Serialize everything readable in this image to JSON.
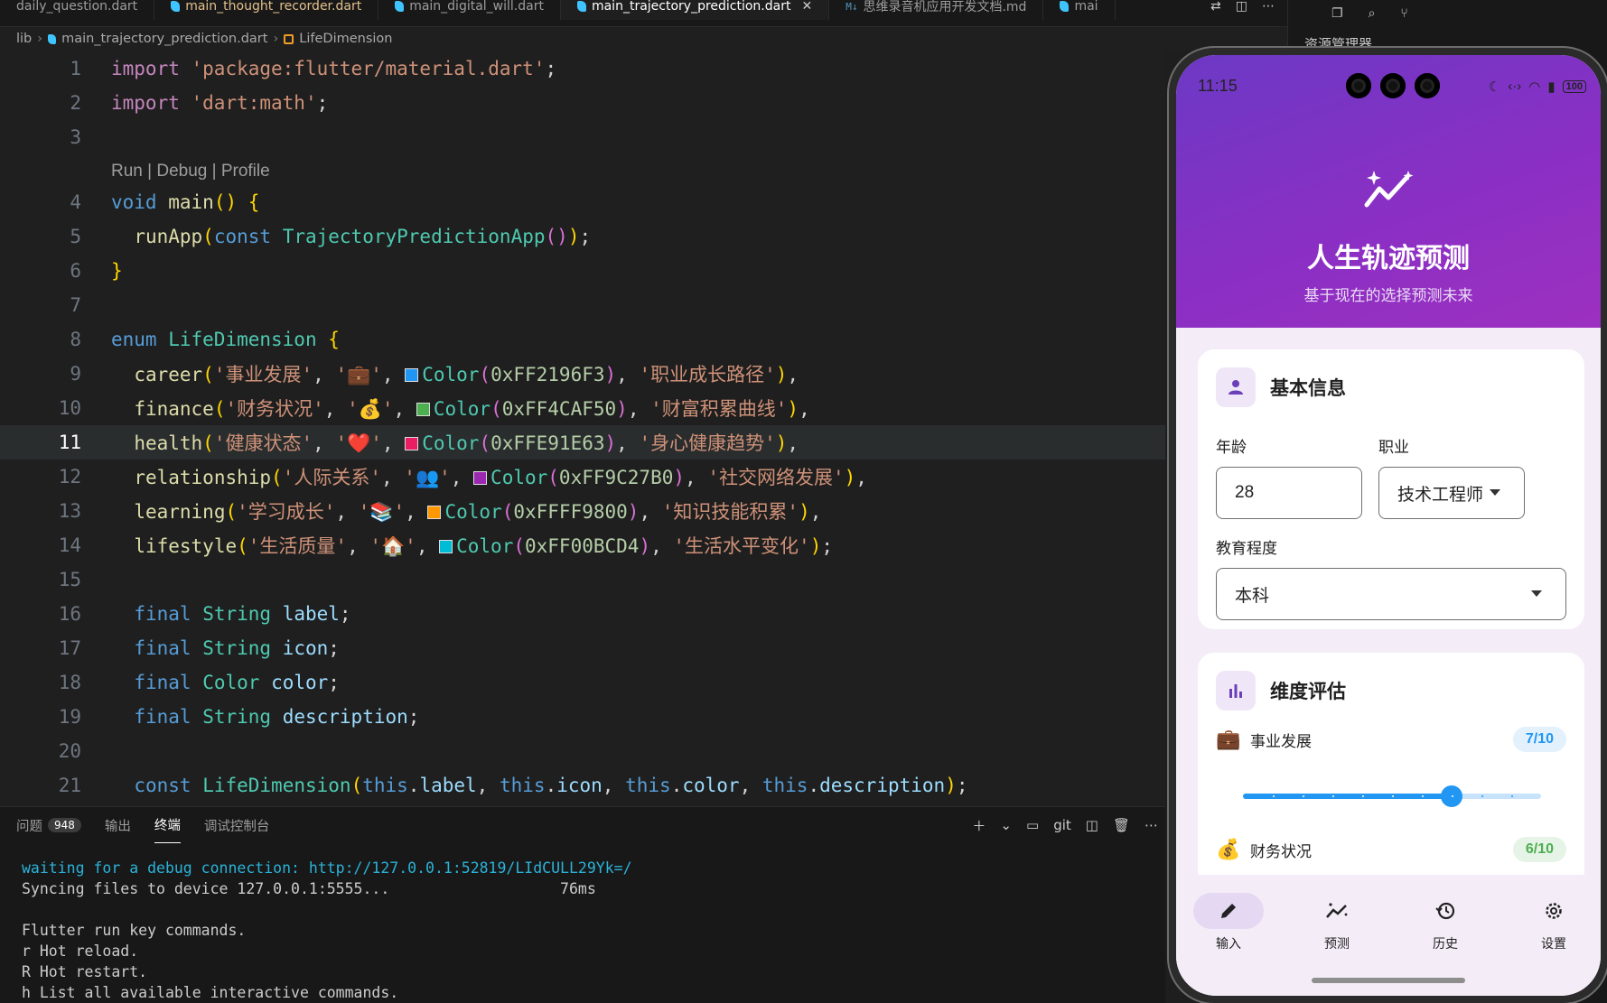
{
  "tabs": [
    {
      "label": "daily_question.dart",
      "type": "dart",
      "modified": false,
      "active": false
    },
    {
      "label": "main_thought_recorder.dart",
      "type": "dart",
      "modified": true,
      "active": false
    },
    {
      "label": "main_digital_will.dart",
      "type": "dart",
      "modified": false,
      "active": false
    },
    {
      "label": "main_trajectory_prediction.dart",
      "type": "dart",
      "modified": false,
      "active": true
    },
    {
      "label": "思维录音机应用开发文档.md",
      "type": "md",
      "modified": false,
      "active": false
    },
    {
      "label": "mai",
      "type": "dart",
      "modified": false,
      "active": false
    }
  ],
  "breadcrumb": {
    "folder": "lib",
    "file": "main_trajectory_prediction.dart",
    "symbol": "LifeDimension"
  },
  "codelens": "Run | Debug | Profile",
  "current_line": 11,
  "code_lines": [
    {
      "n": "1",
      "text": "import 'package:flutter/material.dart';"
    },
    {
      "n": "2",
      "text": "import 'dart:math';"
    },
    {
      "n": "3",
      "text": ""
    },
    {
      "n": "4",
      "text": "void main() {"
    },
    {
      "n": "5",
      "text": "  runApp(const TrajectoryPredictionApp());"
    },
    {
      "n": "6",
      "text": "}"
    },
    {
      "n": "7",
      "text": ""
    },
    {
      "n": "8",
      "text": "enum LifeDimension {"
    },
    {
      "n": "9",
      "text": "  career('事业发展', '💼', Color(0xFF2196F3), '职业成长路径'),"
    },
    {
      "n": "10",
      "text": "  finance('财务状况', '💰', Color(0xFF4CAF50), '财富积累曲线'),"
    },
    {
      "n": "11",
      "text": "  health('健康状态', '❤️', Color(0xFFE91E63), '身心健康趋势'),"
    },
    {
      "n": "12",
      "text": "  relationship('人际关系', '👥', Color(0xFF9C27B0), '社交网络发展'),"
    },
    {
      "n": "13",
      "text": "  learning('学习成长', '📚', Color(0xFFFF9800), '知识技能积累'),"
    },
    {
      "n": "14",
      "text": "  lifestyle('生活质量', '🏠', Color(0xFF00BCD4), '生活水平变化');"
    },
    {
      "n": "15",
      "text": ""
    },
    {
      "n": "16",
      "text": "  final String label;"
    },
    {
      "n": "17",
      "text": "  final String icon;"
    },
    {
      "n": "18",
      "text": "  final Color color;"
    },
    {
      "n": "19",
      "text": "  final String description;"
    },
    {
      "n": "20",
      "text": ""
    },
    {
      "n": "21",
      "text": "  const LifeDimension(this.label, this.icon, this.color, this.description);"
    }
  ],
  "swatches": {
    "9": "#2196F3",
    "10": "#4CAF50",
    "11": "#E91E63",
    "12": "#9C27B0",
    "13": "#FF9800",
    "14": "#00BCD4"
  },
  "panel": {
    "tabs": [
      {
        "label": "问题",
        "badge": "948"
      },
      {
        "label": "输出"
      },
      {
        "label": "终端",
        "active": true
      },
      {
        "label": "调试控制台"
      }
    ],
    "terminal_profile": "git",
    "terminal": [
      {
        "text": "waiting for a debug connection: http://127.0.0.1:52819/LIdCULL29Yk=/",
        "style": "cyan"
      },
      {
        "text": "Syncing files to device 127.0.0.1:5555...                   76ms",
        "style": "normal"
      },
      {
        "text": "",
        "style": "normal"
      },
      {
        "text": "Flutter run key commands.",
        "style": "normal"
      },
      {
        "text": "r Hot reload.",
        "style": "normal"
      },
      {
        "text": "R Hot restart.",
        "style": "normal"
      },
      {
        "text": "h List all available interactive commands.",
        "style": "normal"
      }
    ]
  },
  "explorer_title": "资源管理器",
  "phone": {
    "time": "11:15",
    "battery": "100",
    "app_title": "人生轨迹预测",
    "app_subtitle": "基于现在的选择预测未来",
    "basic_info": {
      "title": "基本信息",
      "age_label": "年龄",
      "age_value": "28",
      "job_label": "职业",
      "job_value": "技术工程师",
      "edu_label": "教育程度",
      "edu_value": "本科"
    },
    "dimensions": {
      "title": "维度评估",
      "items": [
        {
          "icon": "💼",
          "label": "事业发展",
          "score": "7/10",
          "value": 7,
          "max": 10,
          "color": "#2196F3",
          "bg": "#e3f1fd"
        },
        {
          "icon": "💰",
          "label": "财务状况",
          "score": "6/10",
          "value": 6,
          "max": 10,
          "color": "#4CAF50",
          "bg": "#e6f4e7"
        }
      ]
    },
    "nav": [
      {
        "label": "输入",
        "icon": "edit-icon",
        "active": true
      },
      {
        "label": "预测",
        "icon": "trend-icon",
        "active": false
      },
      {
        "label": "历史",
        "icon": "history-icon",
        "active": false
      },
      {
        "label": "设置",
        "icon": "settings-icon",
        "active": false
      }
    ]
  }
}
